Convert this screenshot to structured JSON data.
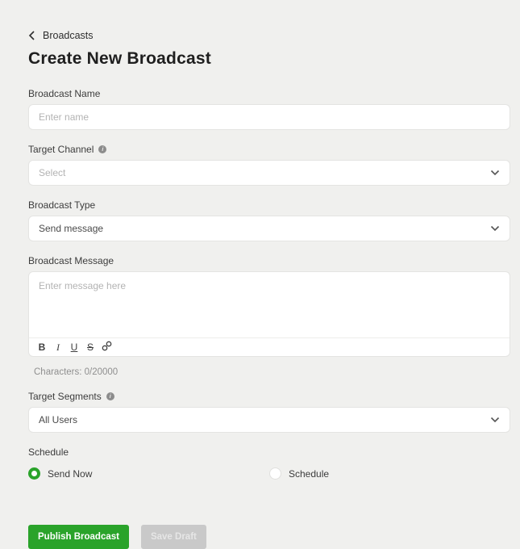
{
  "header": {
    "back_label": "Broadcasts",
    "title": "Create New Broadcast"
  },
  "form": {
    "broadcast_name": {
      "label": "Broadcast Name",
      "placeholder": "Enter name",
      "value": ""
    },
    "target_channel": {
      "label": "Target Channel",
      "selected_value": "Select",
      "is_placeholder": true
    },
    "broadcast_type": {
      "label": "Broadcast Type",
      "selected_value": "Send message"
    },
    "broadcast_message": {
      "label": "Broadcast Message",
      "placeholder": "Enter message here",
      "value": "",
      "toolbar": {
        "bold": "B",
        "italic": "I",
        "underline": "U",
        "strikethrough": "S",
        "link_icon": "link"
      },
      "char_counter": "Characters: 0/20000"
    },
    "target_segments": {
      "label": "Target Segments",
      "selected_value": "All Users"
    },
    "schedule": {
      "label": "Schedule",
      "options": [
        {
          "label": "Send Now",
          "selected": true
        },
        {
          "label": "Schedule",
          "selected": false
        }
      ]
    }
  },
  "actions": {
    "publish_label": "Publish Broadcast",
    "save_draft_label": "Save Draft"
  },
  "colors": {
    "accent_green": "#2aa32a",
    "page_background": "#f0f0ee",
    "input_border": "#e4e4e2",
    "disabled_button": "#c9c9c9"
  }
}
